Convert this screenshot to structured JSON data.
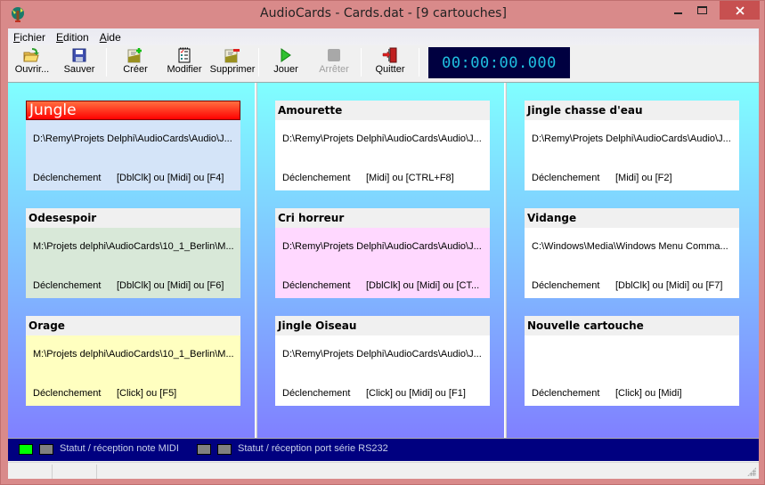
{
  "window": {
    "title": "AudioCards - Cards.dat - [9 cartouches]",
    "controls": {
      "minimize": "‒",
      "maximize": "☐",
      "close": "✕"
    }
  },
  "menu": [
    {
      "label": "Fichier",
      "accel": "F"
    },
    {
      "label": "Edition",
      "accel": "E"
    },
    {
      "label": "Aide",
      "accel": "A"
    }
  ],
  "toolbar": {
    "open": {
      "label": "Ouvrir...",
      "icon": "open-folder-icon"
    },
    "save": {
      "label": "Sauver",
      "icon": "floppy-disk-icon"
    },
    "create": {
      "label": "Créer",
      "icon": "new-card-icon"
    },
    "modify": {
      "label": "Modifier",
      "icon": "checklist-icon"
    },
    "delete": {
      "label": "Supprimer",
      "icon": "delete-card-icon"
    },
    "play": {
      "label": "Jouer",
      "icon": "play-icon"
    },
    "stop": {
      "label": "Arrêter",
      "icon": "stop-icon",
      "disabled": true
    },
    "quit": {
      "label": "Quitter",
      "icon": "exit-door-icon"
    }
  },
  "timer": "00:00:00.000",
  "trigger_label": "Déclenchement",
  "columns": [
    {
      "cards": [
        {
          "title": "Jungle",
          "path": "D:\\Remy\\Projets Delphi\\AudioCards\\Audio\\J...",
          "trigger": "[DblClk] ou [Midi] ou [F4]",
          "color": "#d4e4f8",
          "active": true
        },
        {
          "title": "Odesespoir",
          "path": "M:\\Projets delphi\\AudioCards\\10_1_Berlin\\M...",
          "trigger": "[DblClk] ou [Midi] ou [F6]",
          "color": "#d8e8d8",
          "active": false
        },
        {
          "title": "Orage",
          "path": "M:\\Projets delphi\\AudioCards\\10_1_Berlin\\M...",
          "trigger": "[Click] ou [F5]",
          "color": "#ffffc0",
          "active": false
        }
      ]
    },
    {
      "cards": [
        {
          "title": "Amourette",
          "path": "D:\\Remy\\Projets Delphi\\AudioCards\\Audio\\J...",
          "trigger": "[Midi] ou [CTRL+F8]",
          "color": "#ffffff",
          "active": false
        },
        {
          "title": "Cri horreur",
          "path": "D:\\Remy\\Projets Delphi\\AudioCards\\Audio\\J...",
          "trigger": "[DblClk] ou [Midi] ou [CT...",
          "color": "#ffd8ff",
          "active": false
        },
        {
          "title": "Jingle Oiseau",
          "path": "D:\\Remy\\Projets Delphi\\AudioCards\\Audio\\J...",
          "trigger": "[Click] ou [Midi] ou [F1]",
          "color": "#ffffff",
          "active": false
        }
      ]
    },
    {
      "cards": [
        {
          "title": "Jingle chasse d'eau",
          "path": "D:\\Remy\\Projets Delphi\\AudioCards\\Audio\\J...",
          "trigger": "[Midi] ou [F2]",
          "color": "#ffffff",
          "active": false
        },
        {
          "title": "Vidange",
          "path": "C:\\Windows\\Media\\Windows Menu Comma...",
          "trigger": "[DblClk] ou [Midi] ou [F7]",
          "color": "#ffffff",
          "active": false
        },
        {
          "title": "Nouvelle cartouche",
          "path": "",
          "trigger": "[Click] ou [Midi]",
          "color": "#ffffff",
          "active": false
        }
      ]
    }
  ],
  "status": {
    "midi_label": "Statut / réception note MIDI",
    "midi_leds": [
      "#00ff00",
      "#808080"
    ],
    "serial_label": "Statut / réception port série RS232",
    "serial_leds": [
      "#808080",
      "#808080"
    ]
  }
}
